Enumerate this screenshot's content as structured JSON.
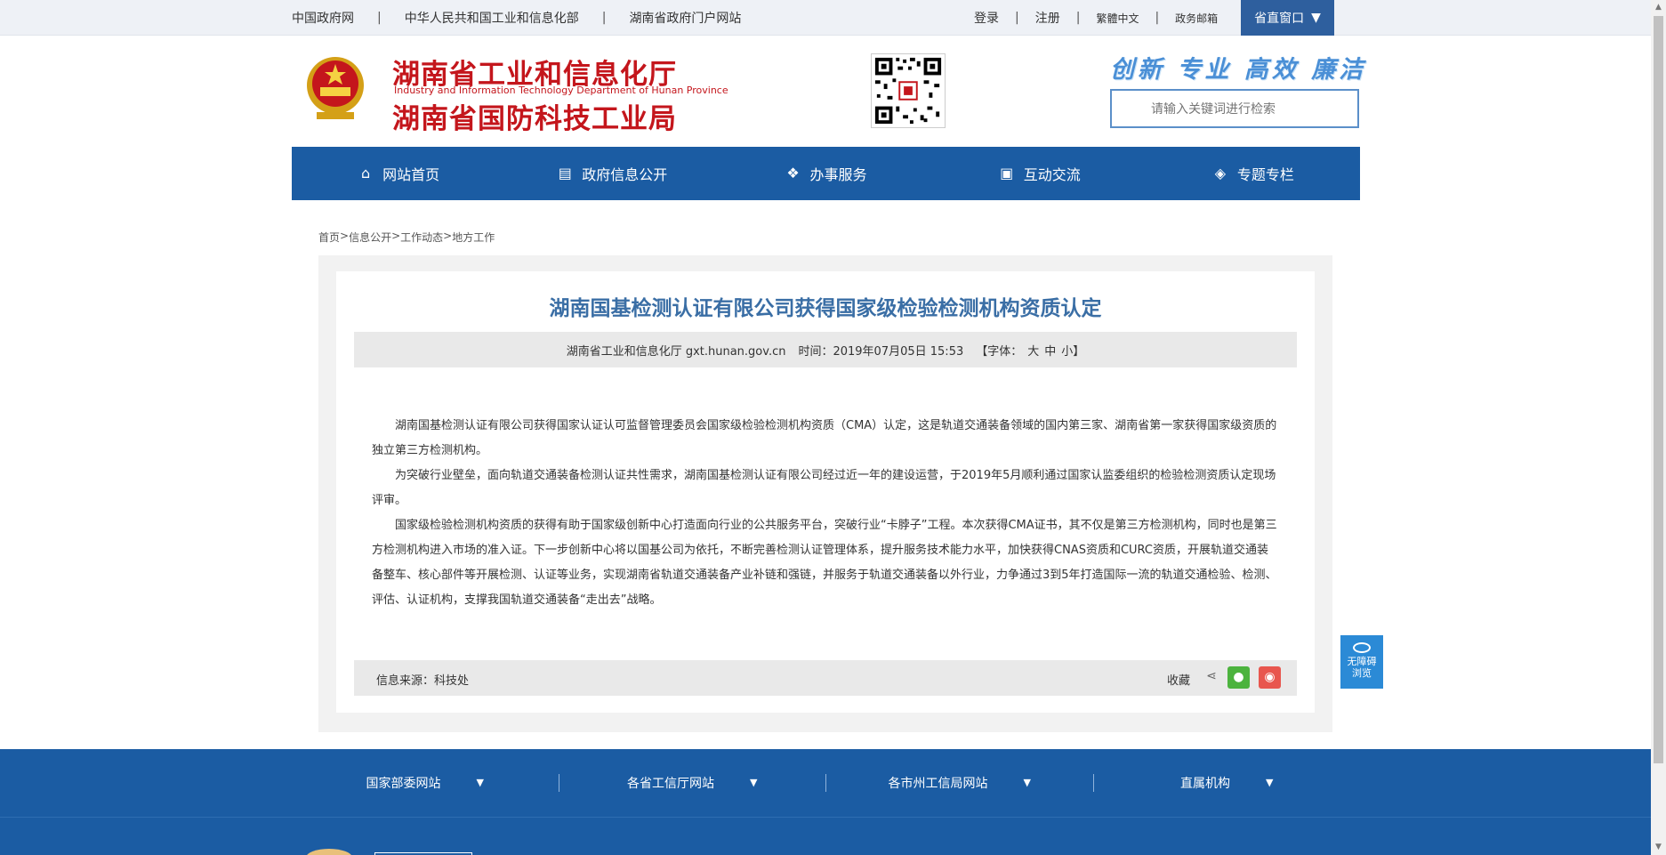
{
  "topbar": {
    "links": [
      "中国政府网",
      "中华人民共和国工业和信息化部",
      "湖南省政府门户网站"
    ],
    "separator": "|",
    "login": "登录",
    "register": "注册",
    "traditional": "繁體中文",
    "mail": "政务邮箱",
    "window": "省直窗口"
  },
  "header": {
    "title_cn1": "湖南省工业和信息化厅",
    "title_en": "Industry and Information Technology Department of Hunan Province",
    "title_cn2": "湖南省国防科技工业局",
    "slogan": "创新 专业 高效 廉洁",
    "search_placeholder": "请输入关键词进行检索"
  },
  "nav": [
    {
      "label": "网站首页",
      "icon": "home-icon"
    },
    {
      "label": "政府信息公开",
      "icon": "document-icon"
    },
    {
      "label": "办事服务",
      "icon": "handshake-icon"
    },
    {
      "label": "互动交流",
      "icon": "chat-icon"
    },
    {
      "label": "专题专栏",
      "icon": "layers-icon"
    }
  ],
  "breadcrumb": [
    "首页",
    "信息公开",
    "工作动态",
    "地方工作"
  ],
  "breadcrumb_sep": ">",
  "article": {
    "title": "湖南国基检测认证有限公司获得国家级检验检测机构资质认定",
    "source_site": "湖南省工业和信息化厅 gxt.hunan.gov.cn",
    "time": "时间：2019年07月05日 15:53",
    "font_label": "【字体：",
    "font_large": "大",
    "font_medium": "中",
    "font_small": "小】",
    "paragraphs": [
      "湖南国基检测认证有限公司获得国家认证认可监督管理委员会国家级检验检测机构资质（CMA）认定，这是轨道交通装备领域的国内第三家、湖南省第一家获得国家级资质的独立第三方检测机构。",
      "为突破行业壁垒，面向轨道交通装备检测认证共性需求，湖南国基检测认证有限公司经过近一年的建设运营，于2019年5月顺利通过国家认监委组织的检验检测资质认定现场评审。",
      "国家级检验检测机构资质的获得有助于国家级创新中心打造面向行业的公共服务平台，突破行业“卡脖子”工程。本次获得CMA证书，其不仅是第三方检测机构，同时也是第三方检测机构进入市场的准入证。下一步创新中心将以国基公司为依托，不断完善检测认证管理体系，提升服务技术能力水平，加快获得CNAS资质和CURC资质，开展轨道交通装备整车、核心部件等开展检测、认证等业务，实现湖南省轨道交通装备产业补链和强链，并服务于轨道交通装备以外行业，力争通过3到5年打造国际一流的轨道交通检验、检测、评估、认证机构，支撑我国轨道交通装备“走出去”战略。"
    ],
    "info_source": "信息来源：科技处",
    "favorite": "收藏"
  },
  "a11y": {
    "line1": "无障碍",
    "line2": "浏览"
  },
  "footer": {
    "links": [
      "国家部委网站",
      "各省工信厅网站",
      "各市州工信局网站",
      "直属机构"
    ]
  }
}
